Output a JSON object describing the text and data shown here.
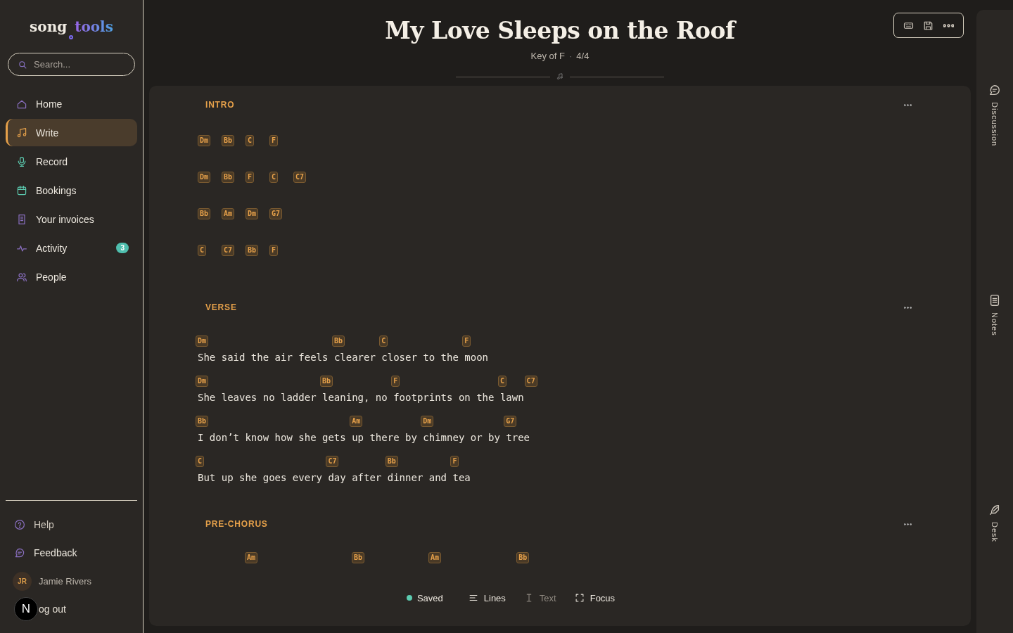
{
  "sidebar": {
    "logo": {
      "word1": "song",
      "word2": "tools"
    },
    "search": {
      "placeholder": "Search..."
    },
    "nav": [
      {
        "label": "Home",
        "selected": false
      },
      {
        "label": "Write",
        "selected": true
      },
      {
        "label": "Record",
        "selected": false
      },
      {
        "label": "Bookings",
        "selected": false
      },
      {
        "label": "Your invoices",
        "selected": false
      },
      {
        "label": "Activity",
        "selected": false,
        "badge": "3"
      },
      {
        "label": "People",
        "selected": false
      }
    ],
    "footer": [
      {
        "kind": "help",
        "label": "Help"
      },
      {
        "kind": "feedback",
        "label": "Feedback"
      },
      {
        "kind": "user",
        "initials": "JR",
        "label": "Jamie Rivers"
      },
      {
        "kind": "logout",
        "label": "og out",
        "overlay": "N"
      }
    ]
  },
  "song": {
    "title": "My Love Sleeps on the Roof",
    "key": "Key of F",
    "separator": "·",
    "meter": "4/4"
  },
  "sections": [
    {
      "label": "INTRO",
      "kind": "chords",
      "rows": [
        [
          "Dm",
          "Bb",
          "C",
          "F"
        ],
        [
          "Dm",
          "Bb",
          "F",
          "C",
          "C7"
        ],
        [
          "Bb",
          "Am",
          "Dm",
          "G7"
        ],
        [
          "C",
          "C7",
          "Bb",
          "F"
        ]
      ]
    },
    {
      "label": "VERSE",
      "kind": "lyrics",
      "lines": [
        [
          {
            "chord": "Dm",
            "text": "She said the air feels "
          },
          {
            "chord": "Bb",
            "text": "clearer "
          },
          {
            "chord": "C",
            "text": "closer to the "
          },
          {
            "chord": "F",
            "text": "moon"
          }
        ],
        [
          {
            "chord": "Dm",
            "text": "She leaves no ladder "
          },
          {
            "chord": "Bb",
            "text": "leaning, no "
          },
          {
            "chord": "F",
            "text": "footprints on the "
          },
          {
            "chord": "C",
            "text": "lawn"
          },
          {
            "chord": "C7"
          }
        ],
        [
          {
            "chord": "Bb",
            "text": "I don’t know how she gets "
          },
          {
            "chord": "Am",
            "text": "up there by "
          },
          {
            "chord": "Dm",
            "text": "chimney or by "
          },
          {
            "chord": "G7",
            "text": "tree"
          }
        ],
        [
          {
            "chord": "C",
            "text": "But up she goes every "
          },
          {
            "chord": "C7",
            "text": "day after "
          },
          {
            "chord": "Bb",
            "text": "dinner and "
          },
          {
            "chord": "F",
            "text": "tea"
          }
        ]
      ]
    },
    {
      "label": "PRE-CHORUS",
      "kind": "chordline",
      "chords": [
        "Am",
        "Bb",
        "Am",
        "Bb"
      ]
    }
  ],
  "statusbar": [
    {
      "kind": "status",
      "label": "Saved",
      "color": "#5ccbb0"
    },
    {
      "kind": "view",
      "label": "Lines",
      "selected": true
    },
    {
      "kind": "view",
      "label": "Text",
      "selected": false
    },
    {
      "kind": "action",
      "label": "Focus"
    }
  ],
  "rail": [
    {
      "label": "Discussion"
    },
    {
      "label": "Notes"
    },
    {
      "label": "Desk"
    }
  ]
}
